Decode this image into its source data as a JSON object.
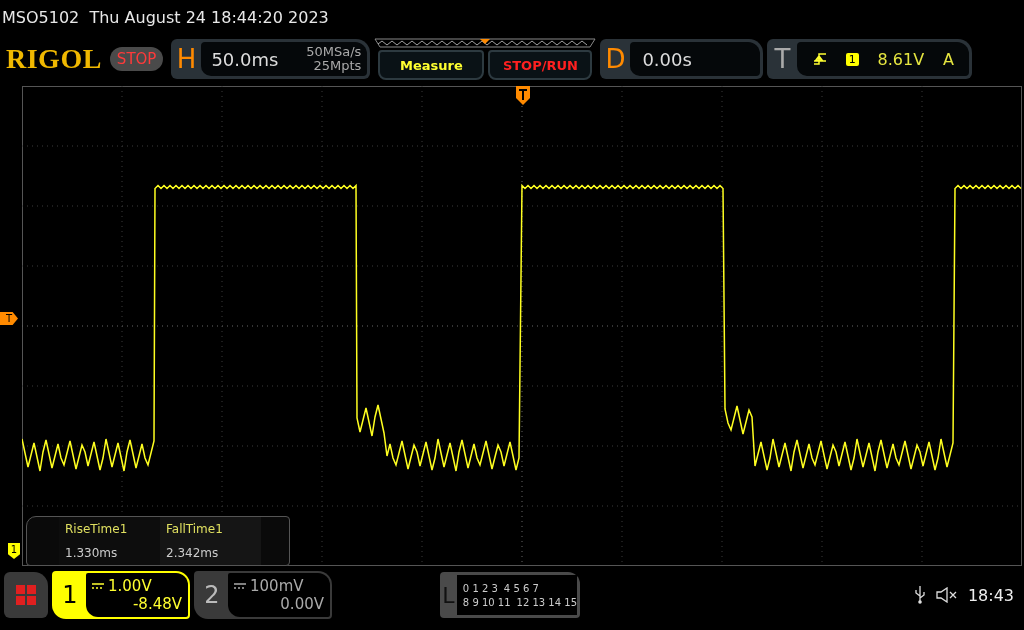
{
  "header": {
    "title": "MSO5102  Thu August 24 18:44:20 2023"
  },
  "toolbar": {
    "logo": "RIGOL",
    "run_state": "STOP",
    "horizontal": {
      "label": "H",
      "timebase": "50.0ms",
      "sample_rate": "50MSa/s",
      "memory_depth": "25Mpts"
    },
    "buttons": [
      {
        "label": "Measure",
        "kind": "measure"
      },
      {
        "label": "STOP/RUN",
        "kind": "stoprun"
      }
    ],
    "delay": {
      "label": "D",
      "value": "0.00s"
    },
    "trigger": {
      "label": "T",
      "channel": "1",
      "level": "8.61V",
      "mode": "A"
    }
  },
  "screen": {
    "trigger_level_marker": "T",
    "channel_marker": "1",
    "measurements": [
      {
        "name": "RiseTime1",
        "value": "1.330ms"
      },
      {
        "name": "FallTime1",
        "value": "2.342ms"
      }
    ]
  },
  "channels": [
    {
      "number": "1",
      "scale": "1.00V",
      "offset": "-8.48V",
      "selected": true
    },
    {
      "number": "2",
      "scale": "100mV",
      "offset": "0.00V",
      "selected": false
    }
  ],
  "logic": {
    "label": "L",
    "rows": [
      [
        "0 1 2 3",
        "4 5 6 7"
      ],
      [
        "8 9 10 11",
        "12 13 14 15"
      ]
    ]
  },
  "status": {
    "time": "18:43"
  }
}
